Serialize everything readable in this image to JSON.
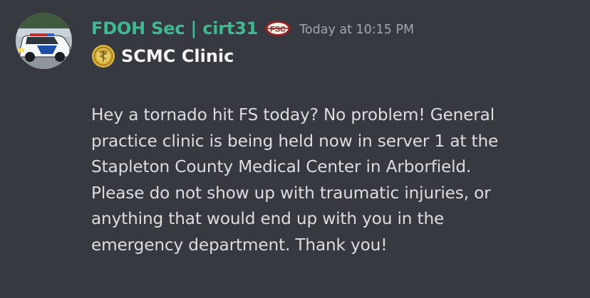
{
  "message": {
    "author": "FDOH Sec | cirt31",
    "badge_text": "FSC",
    "timestamp": "Today at 10:15 PM",
    "clinic_name": "SCMC Clinic",
    "body_lines": [
      "Hey a tornado hit FS today? No problem! General",
      "practice clinic is being held now in server 1 at the",
      "Stapleton County Medical Center in Arborfield.",
      "Please do not show up with traumatic injuries, or",
      "anything that would end up with you in the",
      "emergency department. Thank you!"
    ]
  },
  "colors": {
    "background": "#36393f",
    "username": "#3fb991",
    "timestamp": "#a3a6aa",
    "clinic_name": "#f2f3f5",
    "body_text": "#dcddde",
    "badge": "#8f2424",
    "seal": "#d9b13c"
  },
  "icons": {
    "avatar": "police-suv-photo",
    "badge": "fsc-logo-icon",
    "seal": "medical-seal-icon"
  }
}
